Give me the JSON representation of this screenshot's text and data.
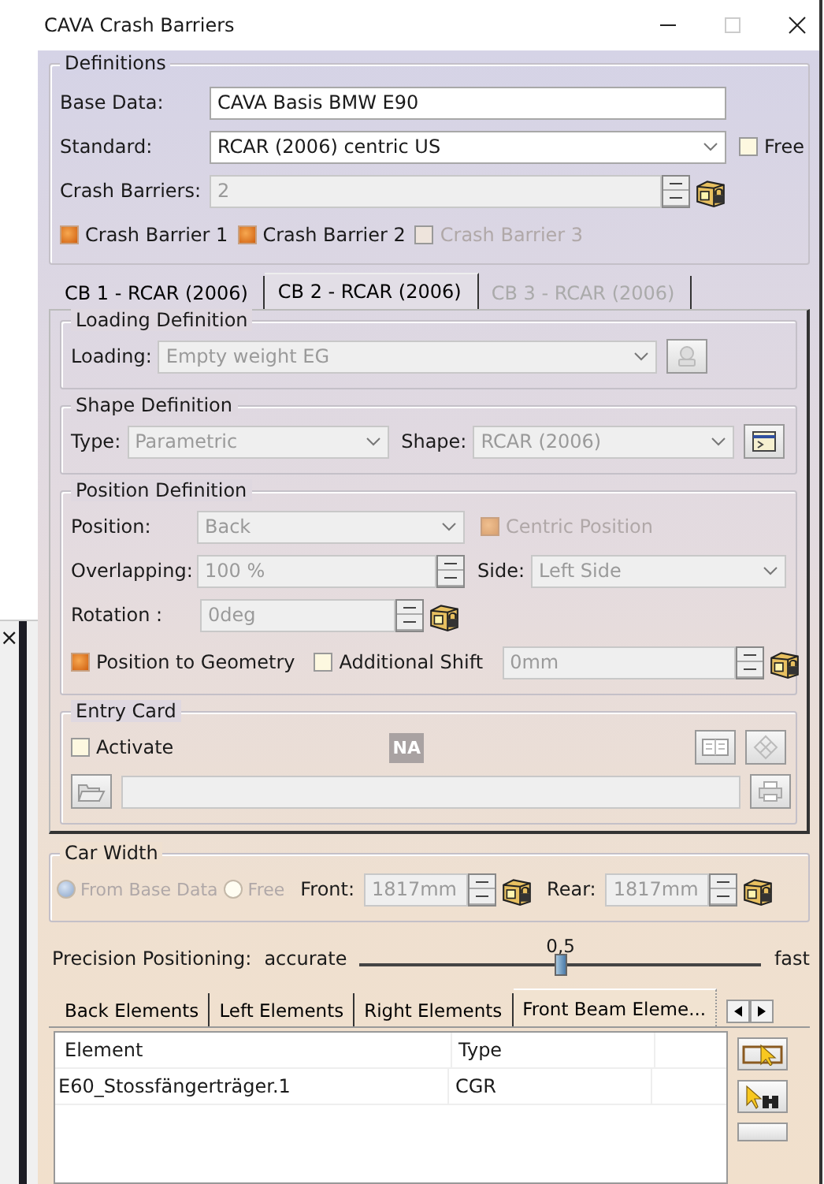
{
  "background_window": {
    "close": "×"
  },
  "window": {
    "title": "CAVA Crash Barriers"
  },
  "definitions": {
    "title": "Definitions",
    "base_data": {
      "label": "Base Data:",
      "value": "CAVA Basis BMW E90",
      "disabled": false
    },
    "standard": {
      "label": "Standard:",
      "value": "RCAR (2006) centric US",
      "disabled": false
    },
    "free": {
      "label": "Free",
      "checked": false,
      "disabled": false
    },
    "crash_barriers": {
      "label": "Crash Barriers:",
      "value": "2",
      "disabled": true
    },
    "barriers": [
      {
        "label": "Crash Barrier 1",
        "checked": true,
        "disabled": false
      },
      {
        "label": "Crash Barrier 2",
        "checked": true,
        "disabled": false
      },
      {
        "label": "Crash Barrier 3",
        "checked": false,
        "disabled": true
      }
    ]
  },
  "tabs": [
    {
      "label": "CB 1 - RCAR (2006)",
      "selected": false,
      "disabled": false
    },
    {
      "label": "CB 2 - RCAR (2006)",
      "selected": true,
      "disabled": false
    },
    {
      "label": "CB 3 - RCAR (2006)",
      "selected": false,
      "disabled": true
    }
  ],
  "loading": {
    "title": "Loading Definition",
    "loading": {
      "label": "Loading:",
      "value": "Empty weight EG",
      "disabled": true
    }
  },
  "shape": {
    "title": "Shape Definition",
    "type": {
      "label": "Type:",
      "value": "Parametric",
      "disabled": true
    },
    "shape": {
      "label": "Shape:",
      "value": "RCAR (2006)",
      "disabled": true
    }
  },
  "position": {
    "title": "Position Definition",
    "position": {
      "label": "Position:",
      "value": "Back",
      "disabled": true
    },
    "centric": {
      "label": "Centric Position",
      "checked": true,
      "disabled": true
    },
    "overlapping": {
      "label": "Overlapping:",
      "value": "100 %",
      "disabled": true
    },
    "side": {
      "label": "Side:",
      "value": "Left Side",
      "disabled": true
    },
    "rotation": {
      "label": "Rotation :",
      "value": "0deg",
      "disabled": true
    },
    "to_geometry": {
      "label": "Position to Geometry",
      "checked": true,
      "disabled": false
    },
    "additional_shift": {
      "label": "Additional Shift",
      "checked": false,
      "disabled": false
    },
    "shift": {
      "value": "0mm",
      "disabled": true
    }
  },
  "entry_card": {
    "title": "Entry Card",
    "activate": {
      "label": "Activate",
      "checked": false,
      "disabled": false
    },
    "badge": "NA"
  },
  "car_width": {
    "title": "Car Width",
    "options": [
      {
        "label": "From Base Data",
        "selected": true,
        "disabled": true
      },
      {
        "label": "Free",
        "selected": false,
        "disabled": true
      }
    ],
    "front": {
      "label": "Front:",
      "value": "1817mm",
      "disabled": true
    },
    "rear": {
      "label": "Rear:",
      "value": "1817mm",
      "disabled": true
    }
  },
  "precision": {
    "label": "Precision Positioning:",
    "min_label": "accurate",
    "max_label": "fast",
    "reading": "0,5",
    "level": 0.5
  },
  "element_tabs": [
    {
      "label": "Back Elements",
      "selected": false
    },
    {
      "label": "Left Elements",
      "selected": false
    },
    {
      "label": "Right Elements",
      "selected": false
    },
    {
      "label": "Front Beam Eleme...",
      "selected": true
    }
  ],
  "table": {
    "columns": [
      "Element",
      "Type"
    ],
    "rows": [
      [
        "E60_Stossfängerträger.1",
        "CGR"
      ]
    ]
  }
}
